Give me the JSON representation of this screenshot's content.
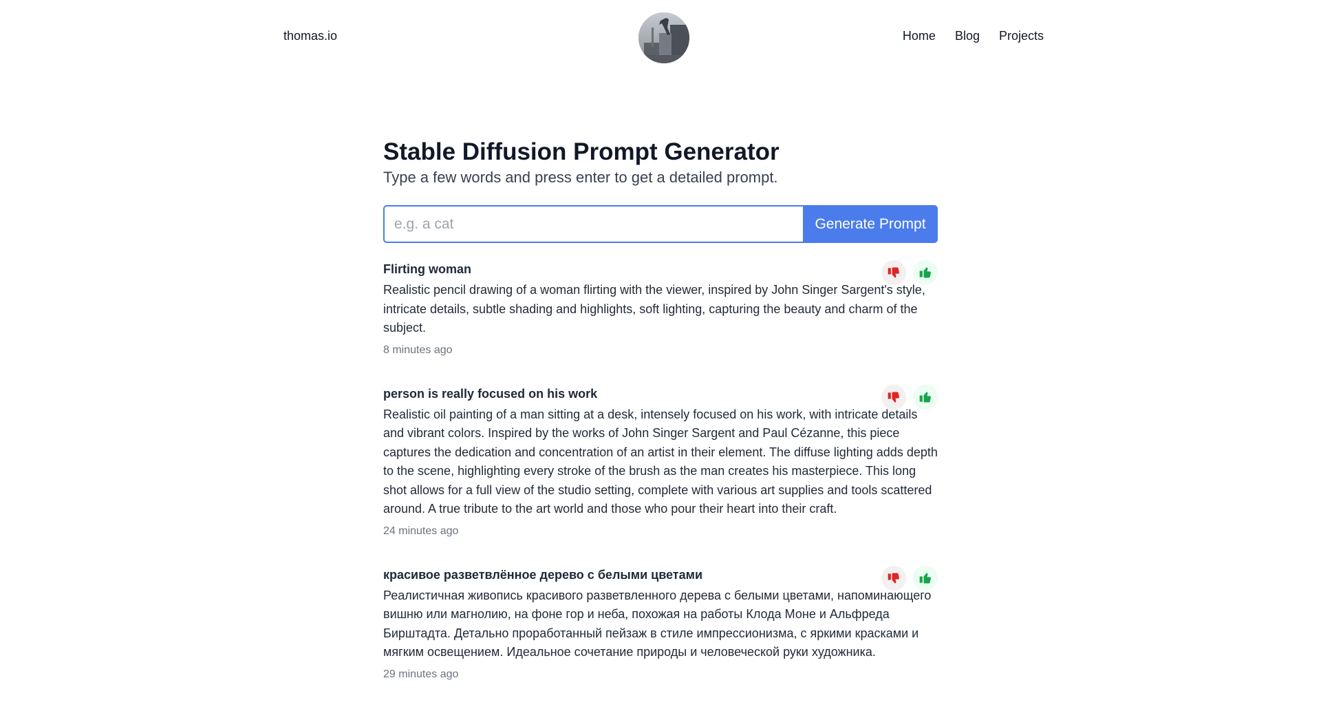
{
  "header": {
    "logo": "thomas.io",
    "nav": [
      {
        "label": "Home"
      },
      {
        "label": "Blog"
      },
      {
        "label": "Projects"
      }
    ]
  },
  "main": {
    "title": "Stable Diffusion Prompt Generator",
    "subtitle": "Type a few words and press enter to get a detailed prompt.",
    "input": {
      "placeholder": "e.g. a cat",
      "value": ""
    },
    "generate_label": "Generate Prompt"
  },
  "colors": {
    "accent": "#4b7ceb",
    "thumbs_down": "#dc2626",
    "thumbs_up": "#16a34a"
  },
  "results": [
    {
      "title": "Flirting woman",
      "body": "Realistic pencil drawing of a woman flirting with the viewer, inspired by John Singer Sargent's style, intricate details, subtle shading and highlights, soft lighting, capturing the beauty and charm of the subject.",
      "time": "8 minutes ago",
      "icons": [
        "thumbs-down-icon",
        "thumbs-up-icon"
      ]
    },
    {
      "title": "person is really focused on his work",
      "body": "Realistic oil painting of a man sitting at a desk, intensely focused on his work, with intricate details and vibrant colors. Inspired by the works of John Singer Sargent and Paul Cézanne, this piece captures the dedication and concentration of an artist in their element. The diffuse lighting adds depth to the scene, highlighting every stroke of the brush as the man creates his masterpiece. This long shot allows for a full view of the studio setting, complete with various art supplies and tools scattered around. A true tribute to the art world and those who pour their heart into their craft.",
      "time": "24 minutes ago",
      "icons": [
        "thumbs-down-icon",
        "thumbs-up-icon"
      ]
    },
    {
      "title": "красивое разветвлённое дерево с белыми цветами",
      "body": "Реалистичная живопись красивого разветвленного дерева с белыми цветами, напоминающего вишню или магнолию, на фоне гор и неба, похожая на работы Клода Моне и Альфреда Бирштадта. Детально проработанный пейзаж в стиле импрессионизма, с яркими красками и мягким освещением. Идеальное сочетание природы и человеческой руки художника.",
      "time": "29 minutes ago",
      "icons": [
        "thumbs-down-icon",
        "thumbs-up-icon"
      ]
    }
  ]
}
